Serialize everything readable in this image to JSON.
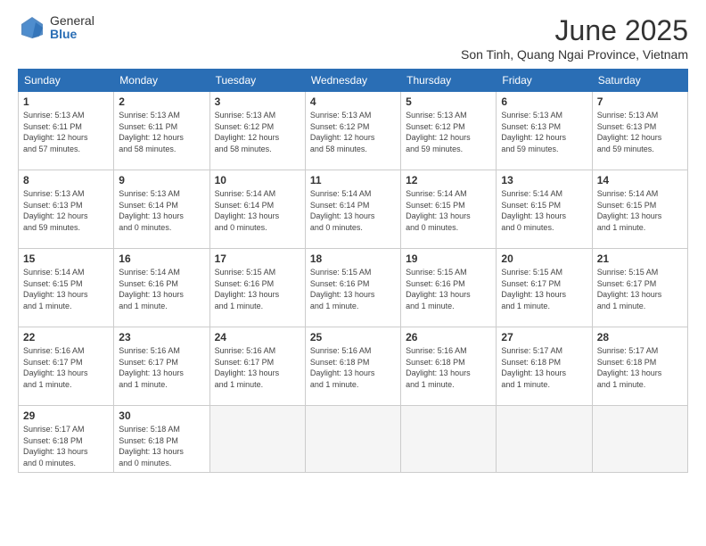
{
  "logo": {
    "general": "General",
    "blue": "Blue"
  },
  "title": "June 2025",
  "subtitle": "Son Tinh, Quang Ngai Province, Vietnam",
  "days": [
    "Sunday",
    "Monday",
    "Tuesday",
    "Wednesday",
    "Thursday",
    "Friday",
    "Saturday"
  ],
  "weeks": [
    [
      {
        "day": "1",
        "content": "Sunrise: 5:13 AM\nSunset: 6:11 PM\nDaylight: 12 hours\nand 57 minutes."
      },
      {
        "day": "2",
        "content": "Sunrise: 5:13 AM\nSunset: 6:11 PM\nDaylight: 12 hours\nand 58 minutes."
      },
      {
        "day": "3",
        "content": "Sunrise: 5:13 AM\nSunset: 6:12 PM\nDaylight: 12 hours\nand 58 minutes."
      },
      {
        "day": "4",
        "content": "Sunrise: 5:13 AM\nSunset: 6:12 PM\nDaylight: 12 hours\nand 58 minutes."
      },
      {
        "day": "5",
        "content": "Sunrise: 5:13 AM\nSunset: 6:12 PM\nDaylight: 12 hours\nand 59 minutes."
      },
      {
        "day": "6",
        "content": "Sunrise: 5:13 AM\nSunset: 6:13 PM\nDaylight: 12 hours\nand 59 minutes."
      },
      {
        "day": "7",
        "content": "Sunrise: 5:13 AM\nSunset: 6:13 PM\nDaylight: 12 hours\nand 59 minutes."
      }
    ],
    [
      {
        "day": "8",
        "content": "Sunrise: 5:13 AM\nSunset: 6:13 PM\nDaylight: 12 hours\nand 59 minutes."
      },
      {
        "day": "9",
        "content": "Sunrise: 5:13 AM\nSunset: 6:14 PM\nDaylight: 13 hours\nand 0 minutes."
      },
      {
        "day": "10",
        "content": "Sunrise: 5:14 AM\nSunset: 6:14 PM\nDaylight: 13 hours\nand 0 minutes."
      },
      {
        "day": "11",
        "content": "Sunrise: 5:14 AM\nSunset: 6:14 PM\nDaylight: 13 hours\nand 0 minutes."
      },
      {
        "day": "12",
        "content": "Sunrise: 5:14 AM\nSunset: 6:15 PM\nDaylight: 13 hours\nand 0 minutes."
      },
      {
        "day": "13",
        "content": "Sunrise: 5:14 AM\nSunset: 6:15 PM\nDaylight: 13 hours\nand 0 minutes."
      },
      {
        "day": "14",
        "content": "Sunrise: 5:14 AM\nSunset: 6:15 PM\nDaylight: 13 hours\nand 1 minute."
      }
    ],
    [
      {
        "day": "15",
        "content": "Sunrise: 5:14 AM\nSunset: 6:15 PM\nDaylight: 13 hours\nand 1 minute."
      },
      {
        "day": "16",
        "content": "Sunrise: 5:14 AM\nSunset: 6:16 PM\nDaylight: 13 hours\nand 1 minute."
      },
      {
        "day": "17",
        "content": "Sunrise: 5:15 AM\nSunset: 6:16 PM\nDaylight: 13 hours\nand 1 minute."
      },
      {
        "day": "18",
        "content": "Sunrise: 5:15 AM\nSunset: 6:16 PM\nDaylight: 13 hours\nand 1 minute."
      },
      {
        "day": "19",
        "content": "Sunrise: 5:15 AM\nSunset: 6:16 PM\nDaylight: 13 hours\nand 1 minute."
      },
      {
        "day": "20",
        "content": "Sunrise: 5:15 AM\nSunset: 6:17 PM\nDaylight: 13 hours\nand 1 minute."
      },
      {
        "day": "21",
        "content": "Sunrise: 5:15 AM\nSunset: 6:17 PM\nDaylight: 13 hours\nand 1 minute."
      }
    ],
    [
      {
        "day": "22",
        "content": "Sunrise: 5:16 AM\nSunset: 6:17 PM\nDaylight: 13 hours\nand 1 minute."
      },
      {
        "day": "23",
        "content": "Sunrise: 5:16 AM\nSunset: 6:17 PM\nDaylight: 13 hours\nand 1 minute."
      },
      {
        "day": "24",
        "content": "Sunrise: 5:16 AM\nSunset: 6:17 PM\nDaylight: 13 hours\nand 1 minute."
      },
      {
        "day": "25",
        "content": "Sunrise: 5:16 AM\nSunset: 6:18 PM\nDaylight: 13 hours\nand 1 minute."
      },
      {
        "day": "26",
        "content": "Sunrise: 5:16 AM\nSunset: 6:18 PM\nDaylight: 13 hours\nand 1 minute."
      },
      {
        "day": "27",
        "content": "Sunrise: 5:17 AM\nSunset: 6:18 PM\nDaylight: 13 hours\nand 1 minute."
      },
      {
        "day": "28",
        "content": "Sunrise: 5:17 AM\nSunset: 6:18 PM\nDaylight: 13 hours\nand 1 minute."
      }
    ],
    [
      {
        "day": "29",
        "content": "Sunrise: 5:17 AM\nSunset: 6:18 PM\nDaylight: 13 hours\nand 0 minutes."
      },
      {
        "day": "30",
        "content": "Sunrise: 5:18 AM\nSunset: 6:18 PM\nDaylight: 13 hours\nand 0 minutes."
      },
      {
        "day": "",
        "content": ""
      },
      {
        "day": "",
        "content": ""
      },
      {
        "day": "",
        "content": ""
      },
      {
        "day": "",
        "content": ""
      },
      {
        "day": "",
        "content": ""
      }
    ]
  ]
}
